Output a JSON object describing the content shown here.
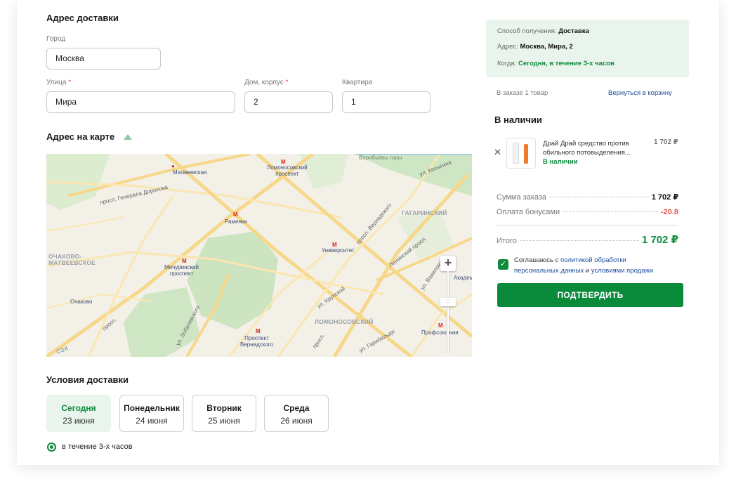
{
  "address": {
    "title": "Адрес доставки",
    "city_label": "Город",
    "city_value": "Москва",
    "street_label": "Улица",
    "street_value": "Мира",
    "house_label": "Дом, корпус",
    "house_value": "2",
    "apt_label": "Квартира",
    "apt_value": "1",
    "required_mark": "*"
  },
  "map": {
    "title": "Адрес на карте",
    "toggle_icon": "triangle-up-icon",
    "labels": {
      "vorobyovy": "Воробьёвы горы",
      "matveevskaya": "Матвеевская",
      "lomonosovsky": "Ломоносовский\nпроспект",
      "kosygina": "ул. Косыгина",
      "gen_dorokhova": "просп. Генерала Дорохова",
      "ramenki": "Раменки",
      "gagarinsky": "ГАГАРИНСКИЙ",
      "vernadskogo_road": "просп. Вернадского",
      "ochakovo_matv": "ОЧАКОВО-\nМАТВЕЕВСКОЕ",
      "universitet": "Университет",
      "leninsky": "Ленинский просп.",
      "michurinsky": "Мичуринский\nпроспект",
      "vavilova": "ул. Вавилова",
      "akadem": "Академ",
      "ochakovo": "Очаково",
      "krupskoy": "ул. Крупской",
      "lomonosovsky_distr": "ЛОМОНОСОВСКИЙ",
      "lobachevskogo": "ул. Лобачевского",
      "profsoyuz": "Профсоюзная",
      "prosp_vernadskogo": "Проспект\nВернадского",
      "garibaldi": "ул. Гарибальди",
      "szkh": "СЗХ",
      "prosp_left": "просп.",
      "zoom_plus": "+"
    }
  },
  "delivery": {
    "title": "Условия доставки",
    "days": [
      {
        "name": "Сегодня",
        "date": "23 июня"
      },
      {
        "name": "Понедельник",
        "date": "24 июня"
      },
      {
        "name": "Вторник",
        "date": "25 июня"
      },
      {
        "name": "Среда",
        "date": "26 июня"
      }
    ],
    "time_option": "в течение 3-х часов"
  },
  "summary": {
    "method_label": "Способ получения: ",
    "method_value": "Доставка",
    "address_label": "Адрес: ",
    "address_value": "Москва, Мира, 2",
    "when_label": "Когда: ",
    "when_value": "Сегодня, в течение 3-х часов",
    "order_count": "В заказе 1 товар",
    "back_link": "Вернуться в корзину",
    "in_stock_title": "В наличии",
    "item": {
      "name_line1": "Драй Драй средство против",
      "name_line2": "обильного потовыделения...",
      "status": "В наличии",
      "price": "1 702 ₽"
    },
    "sum_label": "Сумма заказа",
    "sum_value": "1 702 ₽",
    "bonus_label": "Оплата бонусами",
    "bonus_value": "-20.8",
    "total_label": "Итого",
    "total_value": "1 702 ₽",
    "consent_prefix": "Соглашаюсь с ",
    "consent_link1": "политикой  обработки",
    "consent_link1b": "персональных данных",
    "consent_and": " и ",
    "consent_link2": "условиями продажи",
    "confirm_button": "ПОДТВЕРДИТЬ"
  },
  "colors": {
    "accent_green": "#0a8a3b",
    "light_green": "#e8f4ec",
    "red": "#e2574c",
    "link_blue": "#1c4d9a"
  }
}
